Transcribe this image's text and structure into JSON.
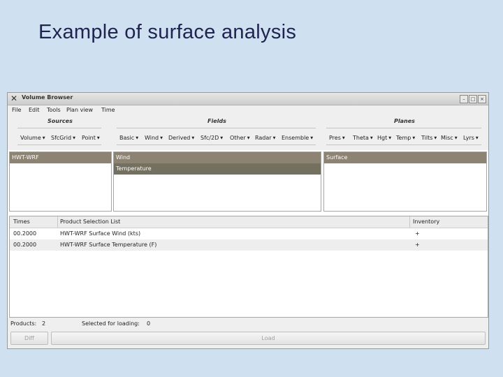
{
  "slide": {
    "title": "Example of surface analysis"
  },
  "window": {
    "title": "Volume Browser",
    "controls": {
      "minimize": "–",
      "maximize": "□",
      "close": "×"
    }
  },
  "menu": [
    "File",
    "Edit",
    "Tools",
    "Plan view",
    "Time"
  ],
  "groups": {
    "sources": {
      "title": "Sources",
      "menus": [
        "Volume",
        "SfcGrid",
        "Point"
      ]
    },
    "fields": {
      "title": "Fields",
      "menus": [
        "Basic",
        "Wind",
        "Derived",
        "Sfc/2D",
        "Other",
        "Radar",
        "Ensemble"
      ]
    },
    "planes": {
      "title": "Planes",
      "menus": [
        "Pres",
        "Theta",
        "Hgt",
        "Temp",
        "Tilts",
        "Misc",
        "Lyrs"
      ]
    }
  },
  "lists": {
    "sources": {
      "items": [
        "HWT-WRF"
      ]
    },
    "fields": {
      "items": [
        "Wind",
        "Temperature"
      ]
    },
    "planes": {
      "items": [
        "Surface"
      ]
    }
  },
  "product_list": {
    "headers": {
      "times": "Times",
      "list": "Product Selection List",
      "inventory": "Inventory"
    },
    "rows": [
      {
        "time": "00.2000",
        "product": "HWT-WRF Surface Wind (kts)",
        "inventory": "+"
      },
      {
        "time": "00.2000",
        "product": "HWT-WRF Surface Temperature (F)",
        "inventory": "+"
      }
    ]
  },
  "status": {
    "products_label": "Products:",
    "products_count": "2",
    "selected_label": "Selected for loading:",
    "selected_count": "0"
  },
  "buttons": {
    "diff": "Diff",
    "load": "Load"
  }
}
